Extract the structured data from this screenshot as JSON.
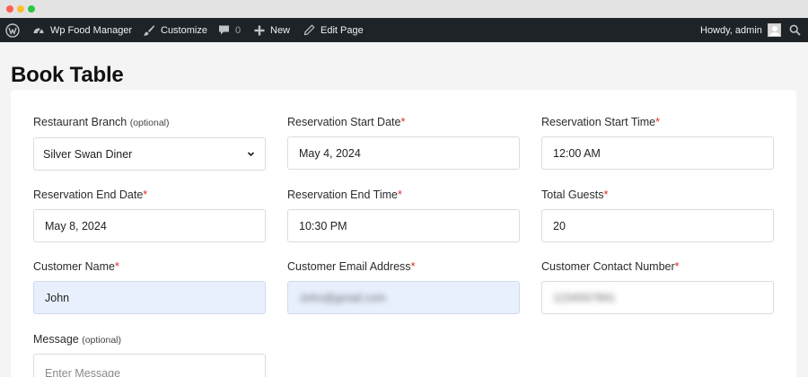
{
  "admin_bar": {
    "site_name": "Wp Food Manager",
    "customize": "Customize",
    "comments_count": "0",
    "new": "New",
    "edit_page": "Edit Page",
    "howdy": "Howdy, admin"
  },
  "page": {
    "title": "Book Table"
  },
  "form": {
    "optional": "(optional)",
    "required_mark": "*",
    "branch": {
      "label": "Restaurant Branch",
      "value": "Silver Swan Diner"
    },
    "start_date": {
      "label": "Reservation Start Date",
      "value": "May 4, 2024"
    },
    "start_time": {
      "label": "Reservation Start Time",
      "value": "12:00 AM"
    },
    "end_date": {
      "label": "Reservation End Date",
      "value": "May 8, 2024"
    },
    "end_time": {
      "label": "Reservation End Time",
      "value": "10:30 PM"
    },
    "guests": {
      "label": "Total Guests",
      "value": "20"
    },
    "name": {
      "label": "Customer Name",
      "value": "John"
    },
    "email": {
      "label": "Customer Email Address",
      "value": "John@gmail.com"
    },
    "phone": {
      "label": "Customer Contact Number",
      "value": "1234567891"
    },
    "message": {
      "label": "Message",
      "placeholder": "Enter Message"
    }
  }
}
